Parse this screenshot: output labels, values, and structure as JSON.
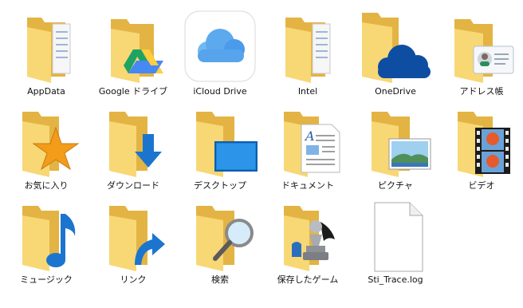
{
  "items": [
    {
      "label": "AppData",
      "icon": "folder-documents-icon"
    },
    {
      "label": "Google ドライブ",
      "icon": "google-drive-folder-icon"
    },
    {
      "label": "iCloud Drive",
      "icon": "icloud-drive-icon"
    },
    {
      "label": "Intel",
      "icon": "folder-documents-icon"
    },
    {
      "label": "OneDrive",
      "icon": "onedrive-folder-icon"
    },
    {
      "label": "アドレス帳",
      "icon": "contacts-folder-icon"
    },
    {
      "label": "お気に入り",
      "icon": "favorites-folder-icon"
    },
    {
      "label": "ダウンロード",
      "icon": "downloads-folder-icon"
    },
    {
      "label": "デスクトップ",
      "icon": "desktop-folder-icon"
    },
    {
      "label": "ドキュメント",
      "icon": "documents-folder-icon"
    },
    {
      "label": "ピクチャ",
      "icon": "pictures-folder-icon"
    },
    {
      "label": "ビデオ",
      "icon": "videos-folder-icon"
    },
    {
      "label": "ミュージック",
      "icon": "music-folder-icon"
    },
    {
      "label": "リンク",
      "icon": "links-folder-icon"
    },
    {
      "label": "検索",
      "icon": "searches-folder-icon"
    },
    {
      "label": "保存したゲーム",
      "icon": "saved-games-folder-icon"
    },
    {
      "label": "Sti_Trace.log",
      "icon": "text-file-icon"
    }
  ],
  "colors": {
    "folder_back": "#e8b94a",
    "folder_front": "#f8d775",
    "accent_blue": "#1b75cf",
    "onedrive_blue": "#0d4ea3"
  }
}
